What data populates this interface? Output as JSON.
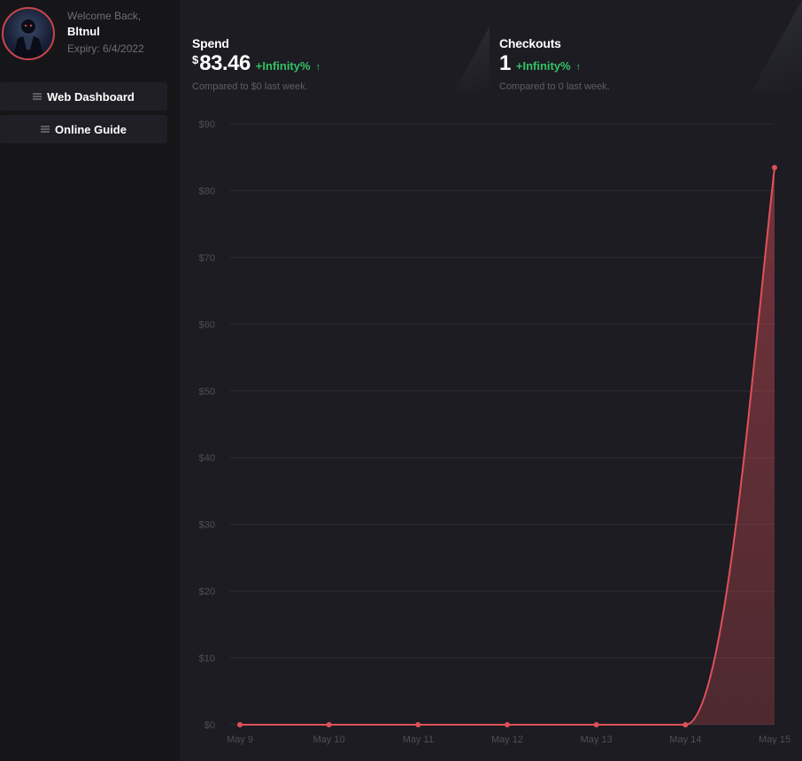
{
  "user": {
    "welcome": "Welcome Back,",
    "name": "Bltnul",
    "expiry": "Expiry: 6/4/2022"
  },
  "sidebar": {
    "items": [
      {
        "label": "Web Dashboard",
        "icon": "list-icon"
      },
      {
        "label": "Online Guide",
        "icon": "list-icon"
      }
    ]
  },
  "stats": {
    "spend": {
      "title": "Spend",
      "currency": "$",
      "value": "83.46",
      "change": "+Infinity%",
      "arrow": "↑",
      "compare": "Compared to $0 last week."
    },
    "checkouts": {
      "title": "Checkouts",
      "value": "1",
      "change": "+Infinity%",
      "arrow": "↑",
      "compare": "Compared to 0 last week."
    }
  },
  "colors": {
    "accent": "#e0505a",
    "positive": "#33c266",
    "background": "#1c1c22",
    "sidebar": "#161619"
  },
  "chart_data": {
    "type": "area",
    "x": [
      "May 9",
      "May 10",
      "May 11",
      "May 12",
      "May 13",
      "May 14",
      "May 15"
    ],
    "values": [
      0,
      0,
      0,
      0,
      0,
      0,
      83.46
    ],
    "ylim": [
      0,
      90
    ],
    "yticks": [
      "$0",
      "$10",
      "$20",
      "$30",
      "$40",
      "$50",
      "$60",
      "$70",
      "$80",
      "$90"
    ],
    "grid": true
  }
}
